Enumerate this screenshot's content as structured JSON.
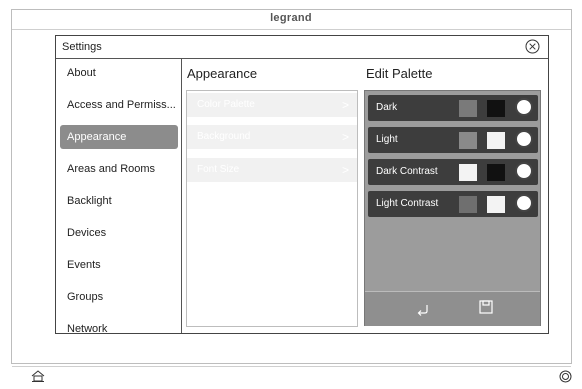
{
  "brand": "legrand",
  "dialog": {
    "title": "Settings",
    "close_icon": "close-circle-icon"
  },
  "sidebar": {
    "items": [
      {
        "label": "About"
      },
      {
        "label": "Access and Permiss..."
      },
      {
        "label": "Appearance",
        "active": true
      },
      {
        "label": "Areas and Rooms"
      },
      {
        "label": "Backlight"
      },
      {
        "label": "Devices"
      },
      {
        "label": "Events"
      },
      {
        "label": "Groups"
      },
      {
        "label": "Network"
      }
    ]
  },
  "appearance": {
    "title": "Appearance",
    "items": [
      {
        "label": "Color Palette"
      },
      {
        "label": "Background"
      },
      {
        "label": "Font Size"
      }
    ]
  },
  "palette": {
    "title": "Edit Palette",
    "rows": [
      {
        "label": "Dark",
        "swatch1": "#7a7a7a",
        "swatch2": "#111111"
      },
      {
        "label": "Light",
        "swatch1": "#8a8a8a",
        "swatch2": "#f3f3f3"
      },
      {
        "label": "Dark Contrast",
        "swatch1": "#f3f3f3",
        "swatch2": "#111111"
      },
      {
        "label": "Light Contrast",
        "swatch1": "#6f6f6f",
        "swatch2": "#f3f3f3"
      }
    ],
    "footer": {
      "undo_icon": "undo-icon",
      "save_icon": "save-icon"
    }
  },
  "bottom": {
    "left_icon": "home-icon",
    "right_icon": "power-circle-icon"
  }
}
